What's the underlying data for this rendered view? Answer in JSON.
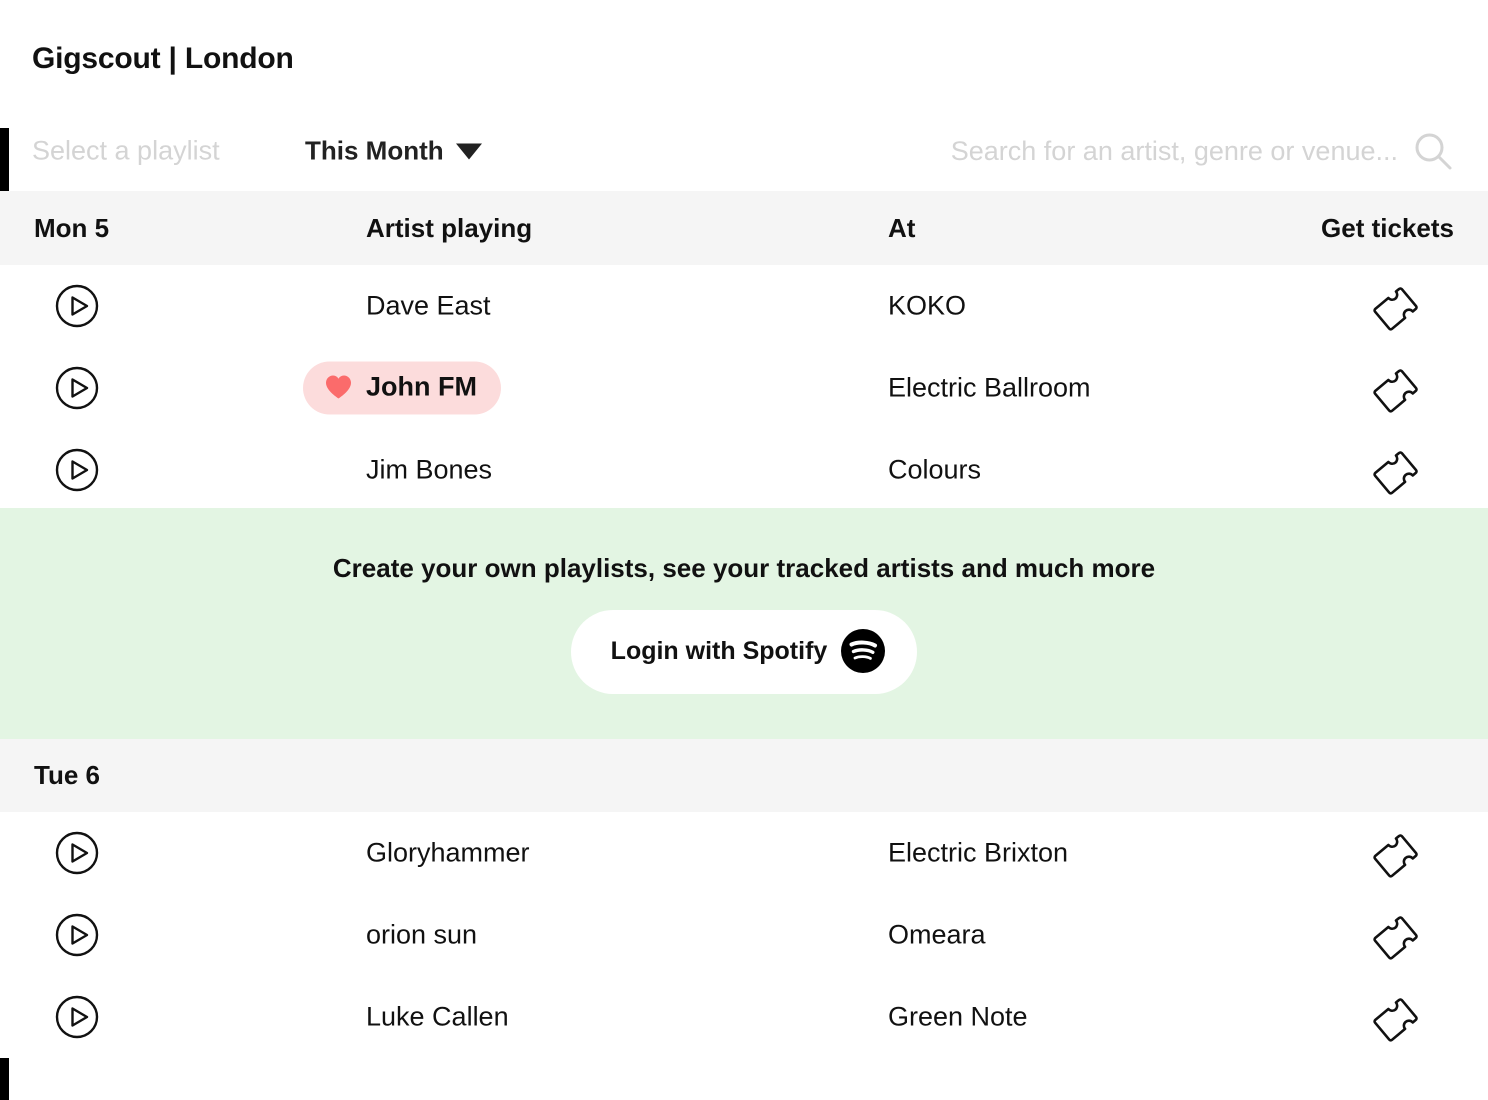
{
  "header": {
    "title": "Gigscout | London"
  },
  "toolbar": {
    "playlist_placeholder": "Select a playlist",
    "month_label": "This Month",
    "caret_icon": "chevron-down-icon",
    "search_placeholder": "Search for an artist, genre or venue...",
    "search_value": "",
    "search_icon": "search-icon"
  },
  "columns": {
    "artist": "Artist playing",
    "at": "At",
    "tickets": "Get tickets"
  },
  "days": [
    {
      "label": "Mon 5",
      "rows": [
        {
          "artist": "Dave East",
          "venue": "KOKO",
          "tracked": false,
          "play_icon": "play-circle-icon",
          "ticket_icon": "ticket-icon"
        },
        {
          "artist": "John FM",
          "venue": "Electric Ballroom",
          "tracked": true,
          "heart_icon": "heart-icon",
          "play_icon": "play-circle-icon",
          "ticket_icon": "ticket-icon"
        },
        {
          "artist": "Jim Bones",
          "venue": "Colours",
          "tracked": false,
          "play_icon": "play-circle-icon",
          "ticket_icon": "ticket-icon"
        }
      ]
    },
    {
      "label": "Tue 6",
      "rows": [
        {
          "artist": "Gloryhammer",
          "venue": "Electric Brixton",
          "tracked": false,
          "play_icon": "play-circle-icon",
          "ticket_icon": "ticket-icon"
        },
        {
          "artist": "orion sun",
          "venue": "Omeara",
          "tracked": false,
          "play_icon": "play-circle-icon",
          "ticket_icon": "ticket-icon"
        },
        {
          "artist": "Luke Callen",
          "venue": "Green Note",
          "tracked": false,
          "play_icon": "play-circle-icon",
          "ticket_icon": "ticket-icon"
        }
      ]
    }
  ],
  "promo": {
    "text": "Create your own playlists, see your tracked artists and much more",
    "button_label": "Login with Spotify",
    "button_icon": "spotify-icon"
  },
  "colors": {
    "accent_green": "#E3F5E3",
    "tracked_pill": "#FCDCDC",
    "heart": "#FB6B6B",
    "header_band": "#F5F5F5",
    "rail": "#000000",
    "muted_text": "#D4D4D4"
  }
}
